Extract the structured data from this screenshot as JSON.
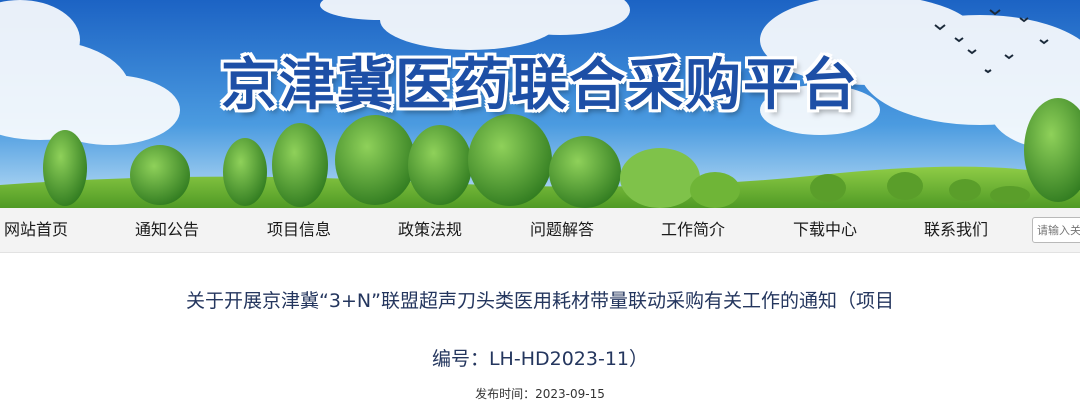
{
  "site": {
    "title": "京津冀医药联合采购平台"
  },
  "nav": {
    "items": [
      "网站首页",
      "通知公告",
      "项目信息",
      "政策法规",
      "问题解答",
      "工作简介",
      "下载中心",
      "联系我们"
    ],
    "search_placeholder": "请输入关"
  },
  "article": {
    "title_line1": "关于开展京津冀“3+N”联盟超声刀头类医用耗材带量联动采购有关工作的通知（项目",
    "title_line2": "编号：LH-HD2023-11）",
    "publish_label": "发布时间：",
    "publish_date": "2023-09-15"
  },
  "colors": {
    "title_blue": "#1d4fa6",
    "sky": "#3c8ad6",
    "grass": "#6fb537",
    "article_title": "#24365e"
  }
}
